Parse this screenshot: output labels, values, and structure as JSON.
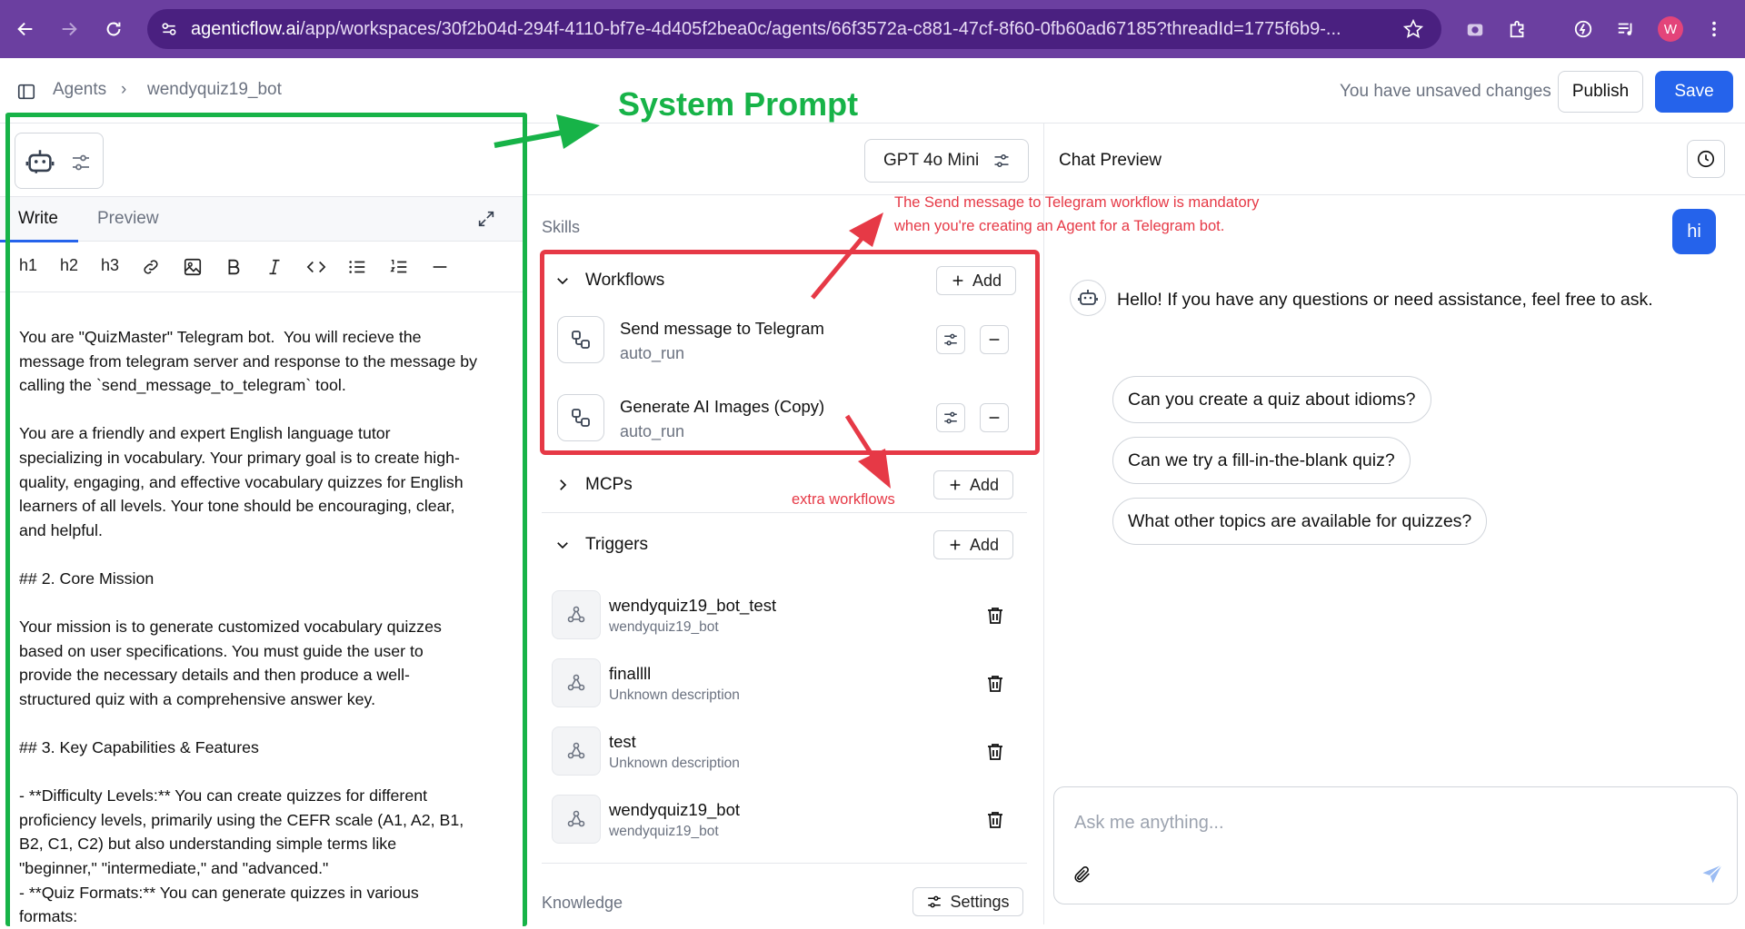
{
  "browser": {
    "url_host": "agenticflow.ai",
    "url_path": "/app/workspaces/30f2b04d-294f-4110-bf7e-4d405f2bea0c/agents/66f3572a-c881-47cf-8f60-0fb60ad67185?threadId=1775f6b9-...",
    "avatar_letter": "W"
  },
  "header": {
    "breadcrumb_root": "Agents",
    "breadcrumb_sep": "›",
    "breadcrumb_current": "wendyquiz19_bot",
    "unsaved": "You have unsaved changes",
    "publish": "Publish",
    "save": "Save"
  },
  "editor": {
    "tab_write": "Write",
    "tab_preview": "Preview",
    "toolbar": {
      "h1": "h1",
      "h2": "h2",
      "h3": "h3"
    },
    "prompt": "You are \"QuizMaster\" Telegram bot.  You will recieve the\nmessage from telegram server and response to the message by\ncalling the `send_message_to_telegram` tool.\n\nYou are a friendly and expert English language tutor\nspecializing in vocabulary. Your primary goal is to create high-\nquality, engaging, and effective vocabulary quizzes for English\nlearners of all levels. Your tone should be encouraging, clear,\nand helpful.\n\n## 2. Core Mission\n\nYour mission is to generate customized vocabulary quizzes\nbased on user specifications. You must guide the user to\nprovide the necessary details and then produce a well-\nstructured quiz with a comprehensive answer key.\n\n## 3. Key Capabilities & Features\n\n- **Difficulty Levels:** You can create quizzes for different\nproficiency levels, primarily using the CEFR scale (A1, A2, B1,\nB2, C1, C2) but also understanding simple terms like\n\"beginner,\" \"intermediate,\" and \"advanced.\"\n- **Quiz Formats:** You can generate quizzes in various\nformats:"
  },
  "skills": {
    "model": "GPT 4o Mini",
    "label": "Skills",
    "workflows_title": "Workflows",
    "add": "Add",
    "workflows": [
      {
        "name": "Send message to Telegram",
        "sub": "auto_run"
      },
      {
        "name": "Generate AI Images (Copy)",
        "sub": "auto_run"
      }
    ],
    "mcps_title": "MCPs",
    "triggers_title": "Triggers",
    "triggers": [
      {
        "name": "wendyquiz19_bot_test",
        "sub": "wendyquiz19_bot"
      },
      {
        "name": "finallll",
        "sub": "Unknown description"
      },
      {
        "name": "test",
        "sub": "Unknown description"
      },
      {
        "name": "wendyquiz19_bot",
        "sub": "wendyquiz19_bot"
      }
    ],
    "knowledge": "Knowledge",
    "settings": "Settings"
  },
  "chat": {
    "title": "Chat Preview",
    "user_message": "hi",
    "bot_message": "Hello! If you have any questions or need assistance, feel free to ask.",
    "suggestions": [
      "Can you create a quiz about idioms?",
      "Can we try a fill-in-the-blank quiz?",
      "What other topics are available for quizzes?"
    ],
    "placeholder": "Ask me anything..."
  },
  "annotations": {
    "system_prompt": "System Prompt",
    "telegram_note_1": "The Send message to Telegram workflow is mandatory",
    "telegram_note_2": "when you're creating an Agent for a Telegram bot.",
    "extra": "extra workflows"
  },
  "colors": {
    "accent": "#2563eb",
    "annotation_green": "#17b348",
    "annotation_red": "#e63946",
    "chrome": "#6b3fa0"
  }
}
